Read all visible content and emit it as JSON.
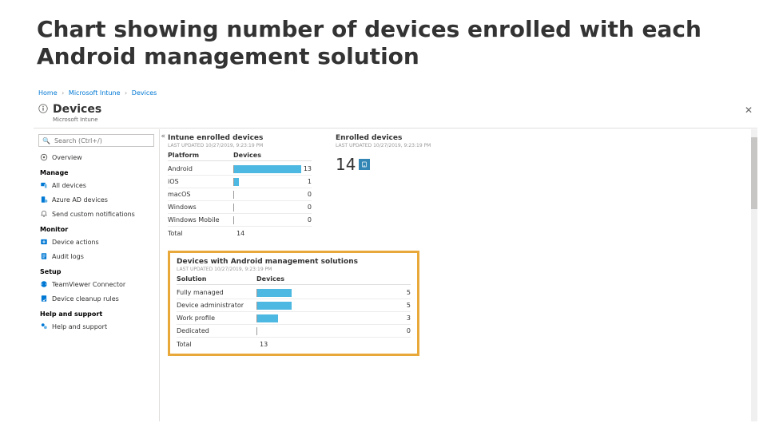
{
  "slide": {
    "title": "Chart showing number of devices enrolled with each Android management solution"
  },
  "breadcrumbs": [
    "Home",
    "Microsoft Intune",
    "Devices"
  ],
  "blade": {
    "title": "Devices",
    "subtitle": "Microsoft Intune"
  },
  "search": {
    "placeholder": "Search (Ctrl+/)"
  },
  "nav": {
    "overview": "Overview",
    "groups": [
      {
        "heading": "Manage",
        "items": [
          {
            "icon": "all-devices",
            "label": "All devices",
            "tint": "#0078d4"
          },
          {
            "icon": "azure-ad",
            "label": "Azure AD devices",
            "tint": "#0078d4"
          },
          {
            "icon": "bell",
            "label": "Send custom notifications",
            "tint": "#605e5c"
          }
        ]
      },
      {
        "heading": "Monitor",
        "items": [
          {
            "icon": "action",
            "label": "Device actions",
            "tint": "#0078d4"
          },
          {
            "icon": "audit",
            "label": "Audit logs",
            "tint": "#0078d4"
          }
        ]
      },
      {
        "heading": "Setup",
        "items": [
          {
            "icon": "teamviewer",
            "label": "TeamViewer Connector",
            "tint": "#0078d4"
          },
          {
            "icon": "cleanup",
            "label": "Device cleanup rules",
            "tint": "#0078d4"
          }
        ]
      },
      {
        "heading": "Help and support",
        "items": [
          {
            "icon": "help",
            "label": "Help and support",
            "tint": "#0078d4"
          }
        ]
      }
    ]
  },
  "panes": {
    "intune": {
      "title": "Intune enrolled devices",
      "updated": "LAST UPDATED 10/27/2019, 9:23:19 PM",
      "colPlatform": "Platform",
      "colDevices": "Devices",
      "rows": [
        {
          "name": "Android",
          "value": 13,
          "max": 14
        },
        {
          "name": "iOS",
          "value": 1,
          "max": 14
        },
        {
          "name": "macOS",
          "value": 0,
          "max": 14
        },
        {
          "name": "Windows",
          "value": 0,
          "max": 14
        },
        {
          "name": "Windows Mobile",
          "value": 0,
          "max": 14
        }
      ],
      "totalLabel": "Total",
      "totalValue": "14"
    },
    "enrolled": {
      "title": "Enrolled devices",
      "updated": "LAST UPDATED 10/27/2019, 9:23:19 PM",
      "big": "14"
    },
    "android": {
      "title": "Devices with Android management solutions",
      "updated": "LAST UPDATED 10/27/2019, 9:23:19 PM",
      "colSolution": "Solution",
      "colDevices": "Devices",
      "rows": [
        {
          "name": "Fully managed",
          "value": 5,
          "max": 14
        },
        {
          "name": "Device administrator",
          "value": 5,
          "max": 14
        },
        {
          "name": "Work profile",
          "value": 3,
          "max": 14
        },
        {
          "name": "Dedicated",
          "value": 0,
          "max": 14
        }
      ],
      "totalLabel": "Total",
      "totalValue": "13"
    }
  },
  "chart_data": [
    {
      "type": "bar",
      "title": "Intune enrolled devices",
      "xlabel": "Platform",
      "ylabel": "Devices",
      "categories": [
        "Android",
        "iOS",
        "macOS",
        "Windows",
        "Windows Mobile"
      ],
      "values": [
        13,
        1,
        0,
        0,
        0
      ],
      "xlim": [
        0,
        14
      ],
      "total": 14,
      "last_updated": "10/27/2019, 9:23:19 PM"
    },
    {
      "type": "bar",
      "title": "Devices with Android management solutions",
      "xlabel": "Solution",
      "ylabel": "Devices",
      "categories": [
        "Fully managed",
        "Device administrator",
        "Work profile",
        "Dedicated"
      ],
      "values": [
        5,
        5,
        3,
        0
      ],
      "xlim": [
        0,
        14
      ],
      "total": 13,
      "last_updated": "10/27/2019, 9:23:19 PM"
    }
  ]
}
